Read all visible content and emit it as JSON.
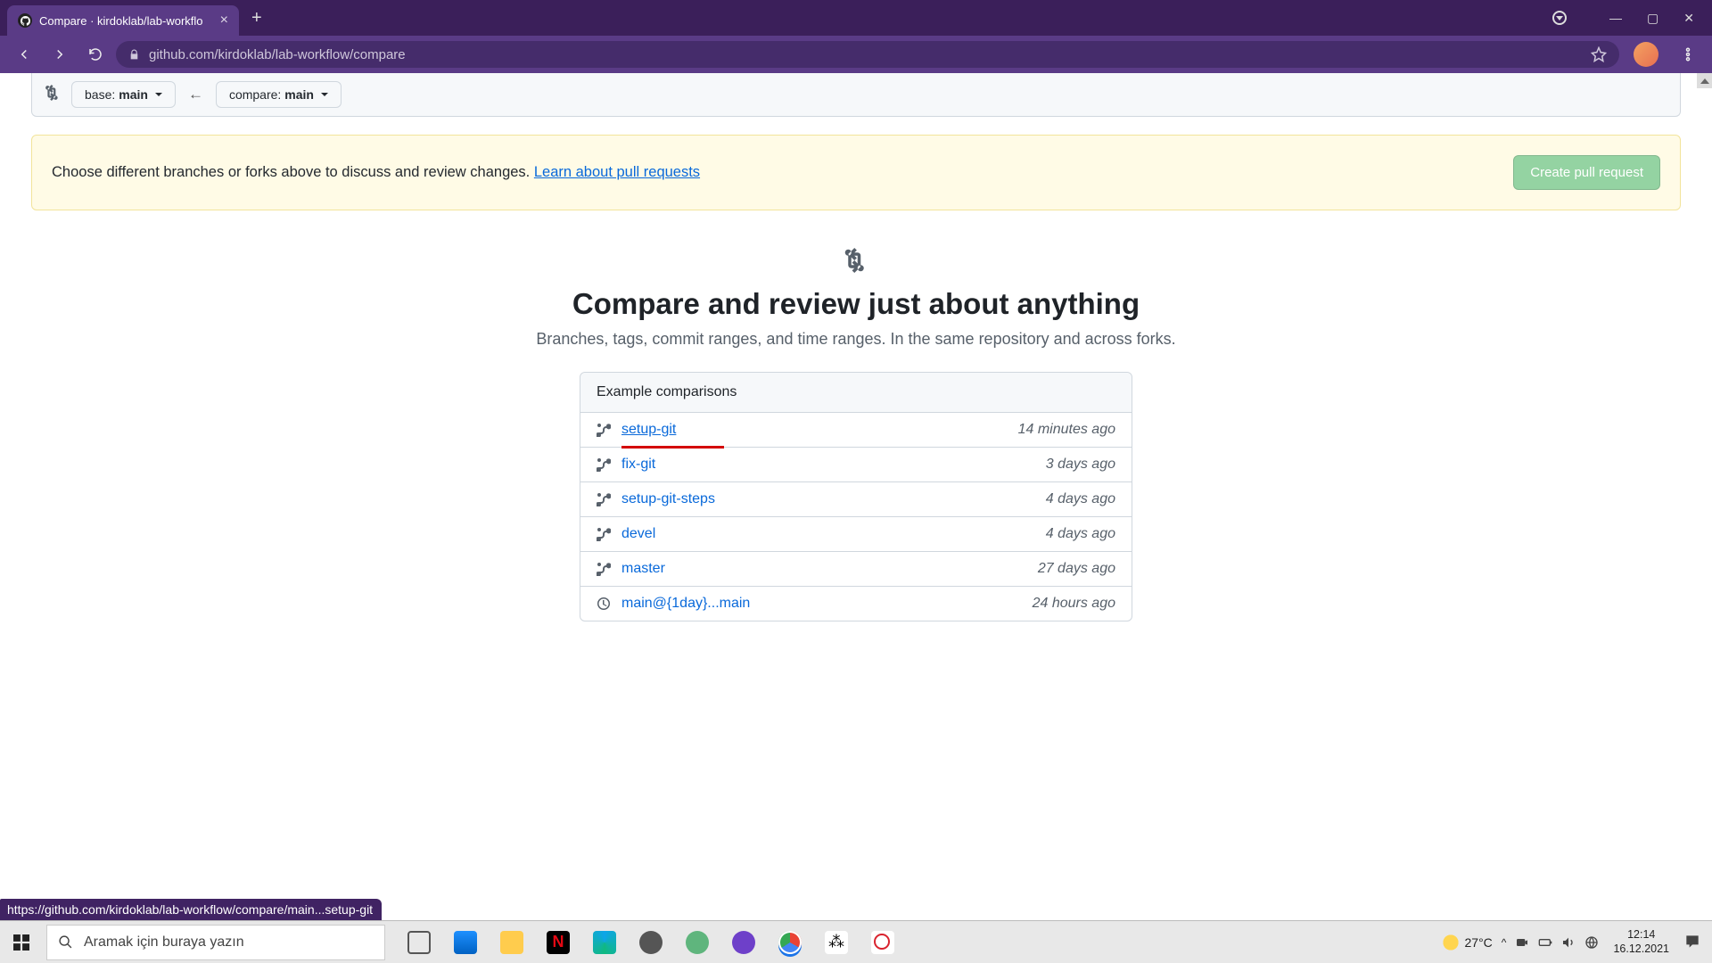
{
  "browser": {
    "tab_title": "Compare · kirdoklab/lab-workflo",
    "url": "github.com/kirdoklab/lab-workflow/compare"
  },
  "compare_bar": {
    "base_prefix": "base: ",
    "base_value": "main",
    "compare_prefix": "compare: ",
    "compare_value": "main"
  },
  "notice": {
    "text": "Choose different branches or forks above to discuss and review changes. ",
    "link": "Learn about pull requests",
    "button": "Create pull request"
  },
  "center": {
    "title": "Compare and review just about anything",
    "subtitle": "Branches, tags, commit ranges, and time ranges. In the same repository and across forks."
  },
  "box": {
    "header": "Example comparisons",
    "rows": [
      {
        "icon": "branch",
        "name": "setup-git",
        "time": "14 minutes ago"
      },
      {
        "icon": "branch",
        "name": "fix-git",
        "time": "3 days ago"
      },
      {
        "icon": "branch",
        "name": "setup-git-steps",
        "time": "4 days ago"
      },
      {
        "icon": "branch",
        "name": "devel",
        "time": "4 days ago"
      },
      {
        "icon": "branch",
        "name": "master",
        "time": "27 days ago"
      },
      {
        "icon": "clock",
        "name": "main@{1day}...main",
        "time": "24 hours ago"
      }
    ]
  },
  "status_link": "https://github.com/kirdoklab/lab-workflow/compare/main...setup-git",
  "taskbar": {
    "search_placeholder": "Aramak için buraya yazın",
    "weather": "27°C",
    "time": "12:14",
    "date": "16.12.2021"
  }
}
